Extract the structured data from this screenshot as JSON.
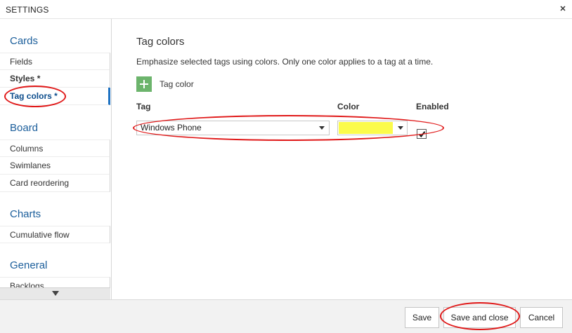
{
  "dialog": {
    "title": "SETTINGS"
  },
  "sidebar": {
    "sections": [
      {
        "title": "Cards",
        "items": [
          {
            "label": "Fields"
          },
          {
            "label": "Styles *"
          },
          {
            "label": "Tag colors *"
          }
        ]
      },
      {
        "title": "Board",
        "items": [
          {
            "label": "Columns"
          },
          {
            "label": "Swimlanes"
          },
          {
            "label": "Card reordering"
          }
        ]
      },
      {
        "title": "Charts",
        "items": [
          {
            "label": "Cumulative flow"
          }
        ]
      },
      {
        "title": "General",
        "items": [
          {
            "label": "Backlogs"
          }
        ]
      }
    ],
    "active_item": "Tag colors *"
  },
  "main": {
    "heading": "Tag colors",
    "description": "Emphasize selected tags using colors. Only one color applies to a tag at a time.",
    "add_label": "Tag color",
    "columns": {
      "tag": "Tag",
      "color": "Color",
      "enabled": "Enabled"
    },
    "row": {
      "tag": "Windows Phone",
      "color": "#fbfb4b",
      "enabled": true
    }
  },
  "footer": {
    "save": "Save",
    "save_close": "Save and close",
    "cancel": "Cancel"
  },
  "icons": {
    "close": "close-icon",
    "add": "plus-icon",
    "dropdown": "chevron-down-icon",
    "check": "checkmark-icon",
    "scroll": "scroll-down-icon"
  },
  "colors": {
    "accent": "#1b5e9b",
    "add_button": "#6cb46c",
    "annotation": "#e01818"
  }
}
